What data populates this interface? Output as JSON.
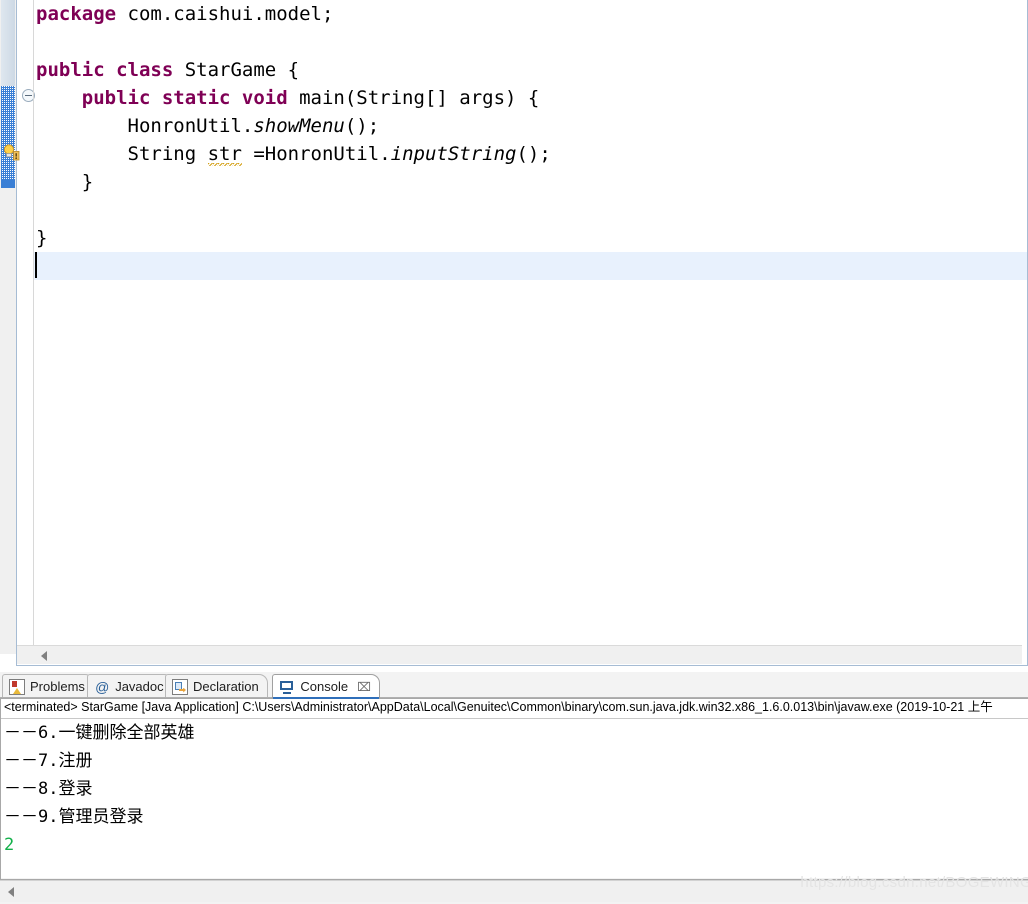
{
  "editor": {
    "language": "java",
    "keyword_color": "#7f0055",
    "current_line_highlight_color": "#e8f1fd",
    "lines": [
      {
        "id": "l1",
        "segments": [
          {
            "t": "package ",
            "k": true
          },
          {
            "t": "com.caishui.model;"
          }
        ]
      },
      {
        "id": "l2",
        "segments": [
          {
            "t": ""
          }
        ]
      },
      {
        "id": "l3",
        "segments": [
          {
            "t": "public class ",
            "k": true
          },
          {
            "t": "StarGame {"
          }
        ]
      },
      {
        "id": "l4",
        "segments": [
          {
            "t": "    "
          },
          {
            "t": "public static void ",
            "k": true
          },
          {
            "t": "main(String[] args) {"
          }
        ]
      },
      {
        "id": "l5",
        "segments": [
          {
            "t": "        HonronUtil."
          },
          {
            "t": "showMenu",
            "i": true
          },
          {
            "t": "();"
          }
        ]
      },
      {
        "id": "l6",
        "segments": [
          {
            "t": "        String "
          },
          {
            "t": "str",
            "w": true
          },
          {
            "t": " =HonronUtil."
          },
          {
            "t": "inputString",
            "i": true
          },
          {
            "t": "();"
          }
        ]
      },
      {
        "id": "l7",
        "segments": [
          {
            "t": "    }"
          }
        ]
      },
      {
        "id": "l8",
        "segments": [
          {
            "t": ""
          }
        ]
      },
      {
        "id": "l9",
        "segments": [
          {
            "t": "}"
          }
        ]
      },
      {
        "id": "l10",
        "segments": [
          {
            "t": ""
          }
        ]
      }
    ],
    "gutter": {
      "quickfix_marker": "quick-fix-warning",
      "fold_marker": "collapse-method"
    },
    "hscroll": {
      "left_arrow": "scroll-left"
    }
  },
  "bottom_panel": {
    "tabs": [
      {
        "label": "Problems",
        "icon": "problems-icon",
        "active": false,
        "closable": false
      },
      {
        "label": "Javadoc",
        "icon": "javadoc-icon",
        "active": false,
        "closable": false
      },
      {
        "label": "Declaration",
        "icon": "declaration-icon",
        "active": false,
        "closable": false
      },
      {
        "label": "Console",
        "icon": "console-icon",
        "active": true,
        "closable": true,
        "close_glyph": "⌧"
      }
    ],
    "console": {
      "launch_line": "<terminated> StarGame [Java Application] C:\\Users\\Administrator\\AppData\\Local\\Genuitec\\Common\\binary\\com.sun.java.jdk.win32.x86_1.6.0.013\\bin\\javaw.exe (2019-10-21 上午",
      "output": [
        {
          "text": "－－6.一键删除全部英雄",
          "stream": "stdout"
        },
        {
          "text": "－－7.注册",
          "stream": "stdout"
        },
        {
          "text": "－－8.登录",
          "stream": "stdout"
        },
        {
          "text": "－－9.管理员登录",
          "stream": "stdout"
        },
        {
          "text": "2",
          "stream": "stdin"
        }
      ],
      "stdin_color": "#13b04a",
      "hscroll": {
        "left_arrow": "scroll-left"
      }
    }
  },
  "watermark": {
    "text": "https://blog.csdn.net/BOGEWING"
  }
}
